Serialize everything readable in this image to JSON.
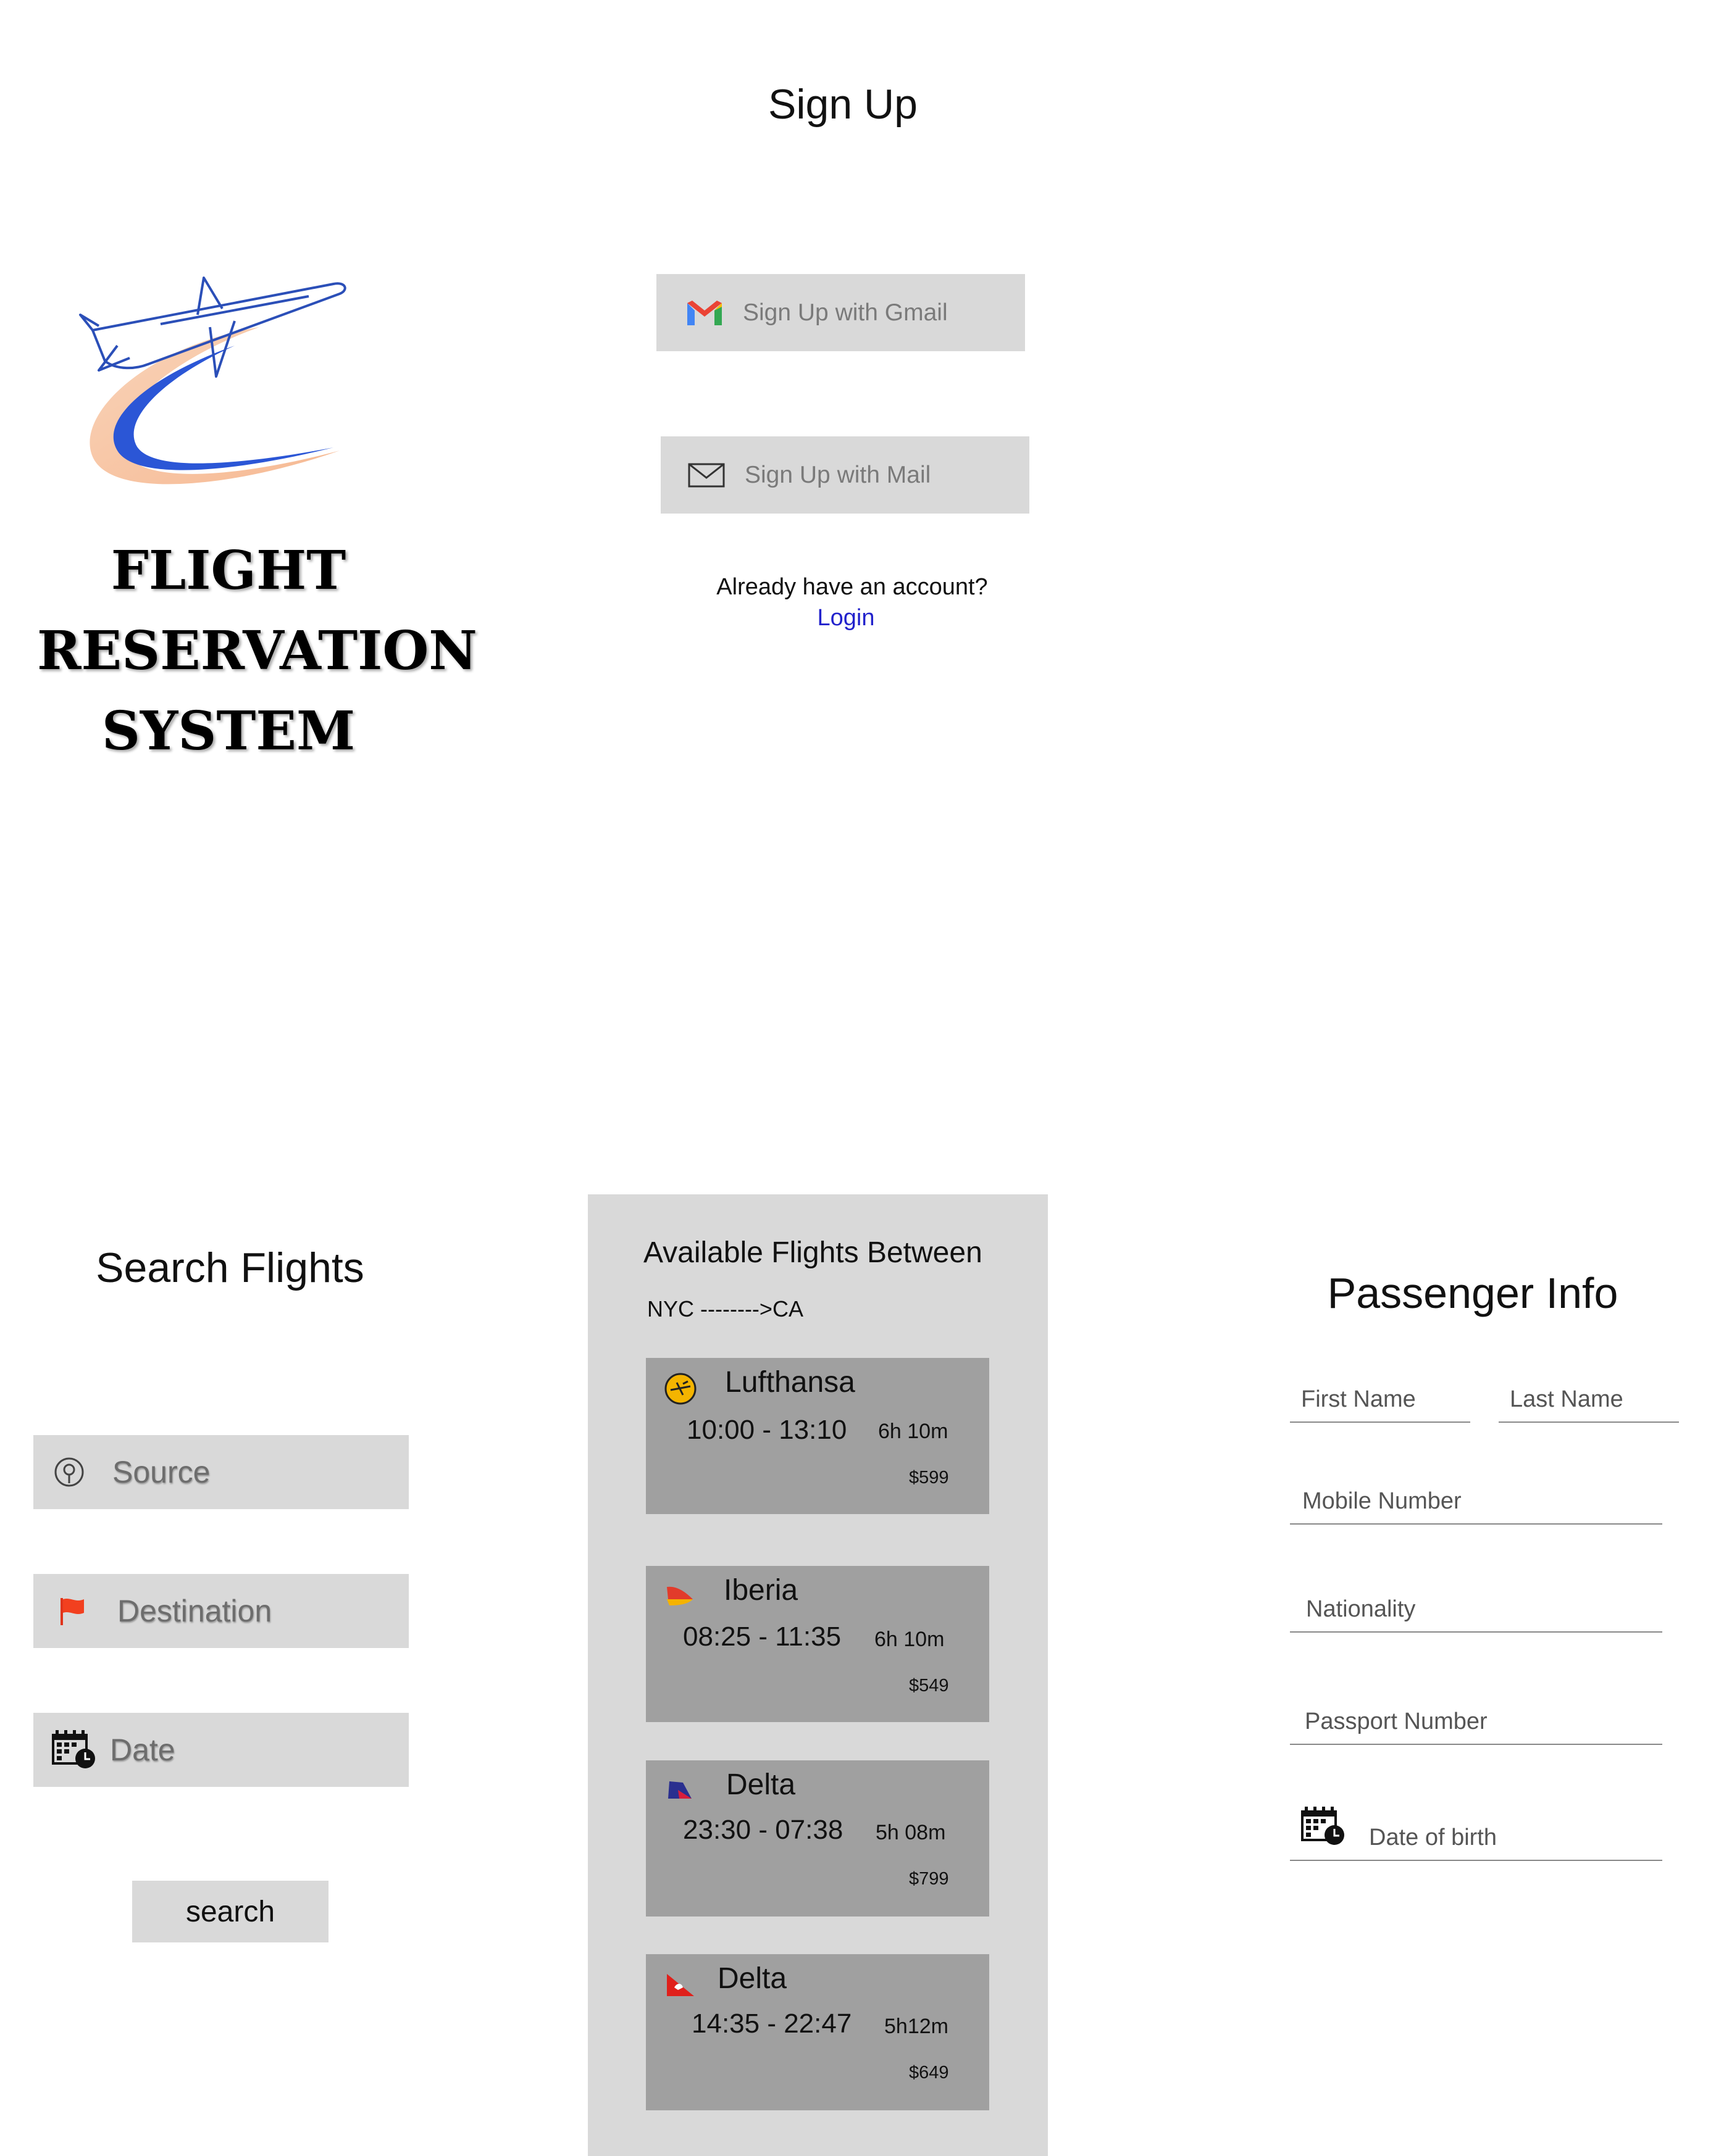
{
  "signup": {
    "title": "Sign Up",
    "brand_lines": [
      "FLIGHT",
      "RESERVATION",
      "SYSTEM"
    ],
    "gmail_button": "Sign Up with Gmail",
    "mail_button": "Sign Up with Mail",
    "already_text": "Already have an account?",
    "login_link": "Login"
  },
  "search": {
    "title": "Search Flights",
    "source": "Source",
    "destination": "Destination",
    "date": "Date",
    "search_button": "search"
  },
  "flights": {
    "title": "Available Flights Between",
    "route": "NYC -------->CA",
    "items": [
      {
        "airline": "Lufthansa",
        "times": "10:00 - 13:10",
        "duration": "6h 10m",
        "price": "$599",
        "icon": "lufthansa-logo-icon"
      },
      {
        "airline": "Iberia",
        "times": "08:25 - 11:35",
        "duration": "6h 10m",
        "price": "$549",
        "icon": "iberia-logo-icon"
      },
      {
        "airline": "Delta",
        "times": "23:30 - 07:38",
        "duration": "5h 08m",
        "price": "$799",
        "icon": "delta-logo-icon"
      },
      {
        "airline": "Delta",
        "times": "14:35 - 22:47",
        "duration": "5h12m",
        "price": "$649",
        "icon": "qantas-logo-icon"
      }
    ]
  },
  "passenger": {
    "title": "Passenger Info",
    "first_name": "First Name",
    "last_name": "Last Name",
    "mobile": "Mobile Number",
    "nationality": "Nationality",
    "passport": "Passport Number",
    "dob": "Date of birth"
  },
  "colors": {
    "field_bg": "#d9d9d9",
    "card_bg": "#a0a0a0",
    "link": "#2222cc"
  }
}
